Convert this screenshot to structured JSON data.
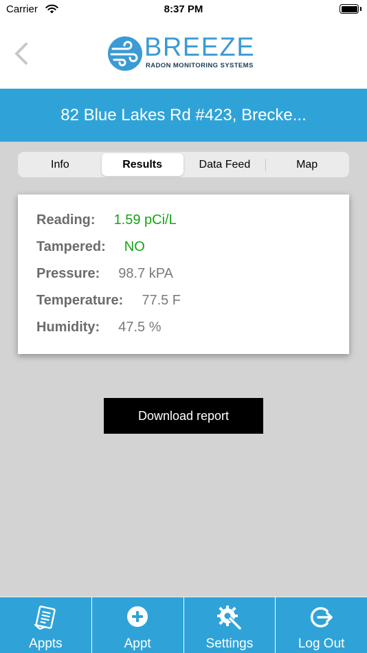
{
  "status_bar": {
    "carrier": "Carrier",
    "time": "8:37 PM"
  },
  "header": {
    "logo_word": "BREEZE",
    "logo_subtitle": "RADON MONITORING SYSTEMS",
    "brand_color": "#3a9bd5"
  },
  "address": "82 Blue Lakes Rd #423, Brecke...",
  "tabs": [
    {
      "label": "Info",
      "active": false
    },
    {
      "label": "Results",
      "active": true
    },
    {
      "label": "Data Feed",
      "active": false
    },
    {
      "label": "Map",
      "active": false
    }
  ],
  "results": {
    "reading": {
      "label": "Reading:",
      "value": "1.59 pCi/L"
    },
    "tampered": {
      "label": "Tampered:",
      "value": "NO"
    },
    "pressure": {
      "label": "Pressure:",
      "value": "98.7 kPA"
    },
    "temperature": {
      "label": "Temperature:",
      "value": "77.5 F"
    },
    "humidity": {
      "label": "Humidity:",
      "value": "47.5 %"
    }
  },
  "download_button": {
    "label": "Download report"
  },
  "tabbar": [
    {
      "label": "Appts",
      "icon": "appointments-list-icon"
    },
    {
      "label": "Appt",
      "icon": "add-circle-icon"
    },
    {
      "label": "Settings",
      "icon": "settings-gear-wrench-icon"
    },
    {
      "label": "Log Out",
      "icon": "logout-icon"
    }
  ],
  "colors": {
    "accent": "#2fa3d8",
    "good_value": "#13a313",
    "background": "#d3d3d3"
  }
}
